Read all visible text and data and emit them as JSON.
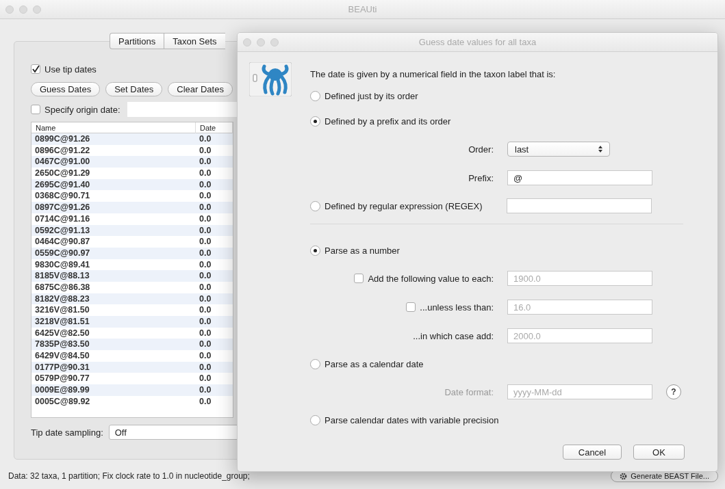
{
  "window": {
    "title": "BEAUti"
  },
  "tabs": [
    {
      "label": "Partitions",
      "selected": false
    },
    {
      "label": "Taxon Sets",
      "selected": false
    }
  ],
  "use_tip_dates": {
    "label": "Use tip dates",
    "checked": true
  },
  "buttons": [
    "Guess Dates",
    "Set Dates",
    "Clear Dates"
  ],
  "origin_date": {
    "label": "Specify origin date:",
    "checked": false
  },
  "table": {
    "columns": [
      "Name",
      "Date"
    ],
    "rows": [
      [
        "0899C@91.26",
        "0.0"
      ],
      [
        "0896C@91.22",
        "0.0"
      ],
      [
        "0467C@91.00",
        "0.0"
      ],
      [
        "2650C@91.29",
        "0.0"
      ],
      [
        "2695C@91.40",
        "0.0"
      ],
      [
        "0368C@90.71",
        "0.0"
      ],
      [
        "0897C@91.26",
        "0.0"
      ],
      [
        "0714C@91.16",
        "0.0"
      ],
      [
        "0592C@91.13",
        "0.0"
      ],
      [
        "0464C@90.87",
        "0.0"
      ],
      [
        "0559C@90.97",
        "0.0"
      ],
      [
        "9830C@89.41",
        "0.0"
      ],
      [
        "8185V@88.13",
        "0.0"
      ],
      [
        "6875C@86.38",
        "0.0"
      ],
      [
        "8182V@88.23",
        "0.0"
      ],
      [
        "3216V@81.50",
        "0.0"
      ],
      [
        "3218V@81.51",
        "0.0"
      ],
      [
        "6425V@82.50",
        "0.0"
      ],
      [
        "7835P@83.50",
        "0.0"
      ],
      [
        "6429V@84.50",
        "0.0"
      ],
      [
        "0177P@90.31",
        "0.0"
      ],
      [
        "0579P@90.77",
        "0.0"
      ],
      [
        "0009E@89.99",
        "0.0"
      ],
      [
        "0005C@89.92",
        "0.0"
      ]
    ]
  },
  "tip_date_sampling": {
    "label": "Tip date sampling:",
    "value": "Off"
  },
  "status_bar": "Data: 32 taxa, 1 partition; Fix clock rate to 1.0 in nucleotide_group;",
  "generate_button": "Generate BEAST File...",
  "dialog": {
    "title": "Guess date values for all taxa",
    "heading": "The date is given by a numerical field in the taxon label that is:",
    "items": [
      {
        "kind": "radio",
        "label": "Defined just by its order",
        "selected": false
      },
      {
        "kind": "radio",
        "label": "Defined by a prefix and its order",
        "selected": true
      },
      {
        "kind": "select",
        "label": "Order:",
        "value": "last"
      },
      {
        "kind": "field",
        "label": "Prefix:",
        "value": "@",
        "disabled": false
      },
      {
        "kind": "radio",
        "label": "Defined by regular expression (REGEX)",
        "selected": false,
        "field": true
      },
      {
        "kind": "divider"
      },
      {
        "kind": "radio",
        "label": "Parse as a number",
        "selected": true
      },
      {
        "kind": "field",
        "label": "Add the following value to each:",
        "value": "1900.0",
        "disabled": true,
        "checked": false
      },
      {
        "kind": "field",
        "label": "...unless less than:",
        "value": "16.0",
        "disabled": true,
        "checked": false
      },
      {
        "kind": "field",
        "label": "...in which case add:",
        "value": "2000.0",
        "disabled": true
      },
      {
        "kind": "radio",
        "label": "Parse as a calendar date",
        "selected": false
      },
      {
        "kind": "field",
        "label": "Date format:",
        "value": "yyyy-MM-dd",
        "disabled": true,
        "label_disabled": true,
        "help": "?"
      },
      {
        "kind": "radio",
        "label": "Parse calendar dates with variable precision",
        "selected": false
      }
    ],
    "buttons": [
      "Cancel",
      "OK"
    ]
  }
}
